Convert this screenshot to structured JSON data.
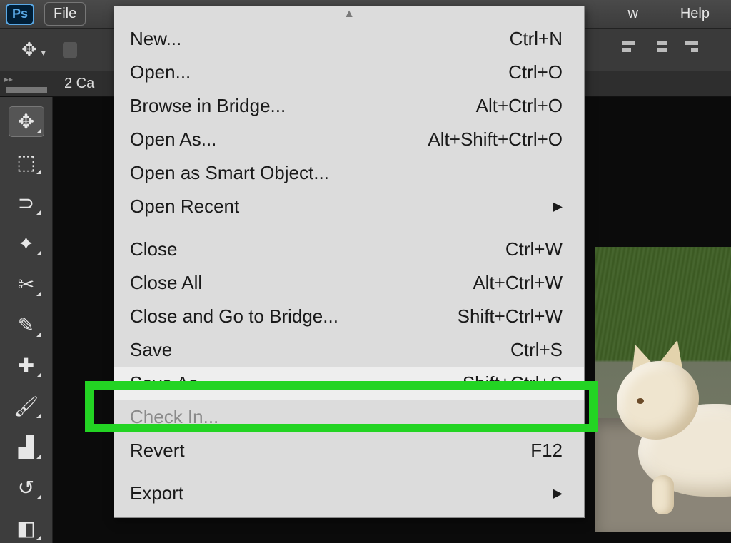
{
  "menubar": {
    "app_initials": "Ps",
    "file_label": "File",
    "window_tail": "w",
    "help_label": "Help"
  },
  "tabstrip": {
    "doc_tab": "2 Ca",
    "panel_toggle": "▸▸"
  },
  "toolbox": {
    "tools": [
      {
        "name": "move-tool",
        "glyph": "✥",
        "selected": true
      },
      {
        "name": "marquee-tool",
        "glyph": "⬚"
      },
      {
        "name": "lasso-tool",
        "glyph": "⊃"
      },
      {
        "name": "quick-select-tool",
        "glyph": "✦"
      },
      {
        "name": "crop-tool",
        "glyph": "✂"
      },
      {
        "name": "eyedropper-tool",
        "glyph": "✎"
      },
      {
        "name": "healing-brush-tool",
        "glyph": "✚"
      },
      {
        "name": "brush-tool",
        "glyph": "🖌"
      },
      {
        "name": "clone-stamp-tool",
        "glyph": "▟"
      },
      {
        "name": "history-brush-tool",
        "glyph": "↺"
      },
      {
        "name": "eraser-tool",
        "glyph": "◧"
      }
    ]
  },
  "file_menu": {
    "scroll_up": "▲",
    "items_group1": [
      {
        "label": "New...",
        "shortcut": "Ctrl+N"
      },
      {
        "label": "Open...",
        "shortcut": "Ctrl+O"
      },
      {
        "label": "Browse in Bridge...",
        "shortcut": "Alt+Ctrl+O"
      },
      {
        "label": "Open As...",
        "shortcut": "Alt+Shift+Ctrl+O"
      },
      {
        "label": "Open as Smart Object...",
        "shortcut": ""
      },
      {
        "label": "Open Recent",
        "shortcut": "",
        "submenu": true
      }
    ],
    "items_group2": [
      {
        "label": "Close",
        "shortcut": "Ctrl+W"
      },
      {
        "label": "Close All",
        "shortcut": "Alt+Ctrl+W"
      },
      {
        "label": "Close and Go to Bridge...",
        "shortcut": "Shift+Ctrl+W"
      },
      {
        "label": "Save",
        "shortcut": "Ctrl+S"
      },
      {
        "label": "Save As...",
        "shortcut": "Shift+Ctrl+S",
        "highlighted": true
      },
      {
        "label": "Check In...",
        "shortcut": "",
        "disabled": true
      },
      {
        "label": "Revert",
        "shortcut": "F12"
      }
    ],
    "items_group3": [
      {
        "label": "Export",
        "shortcut": "",
        "submenu": true
      }
    ]
  }
}
